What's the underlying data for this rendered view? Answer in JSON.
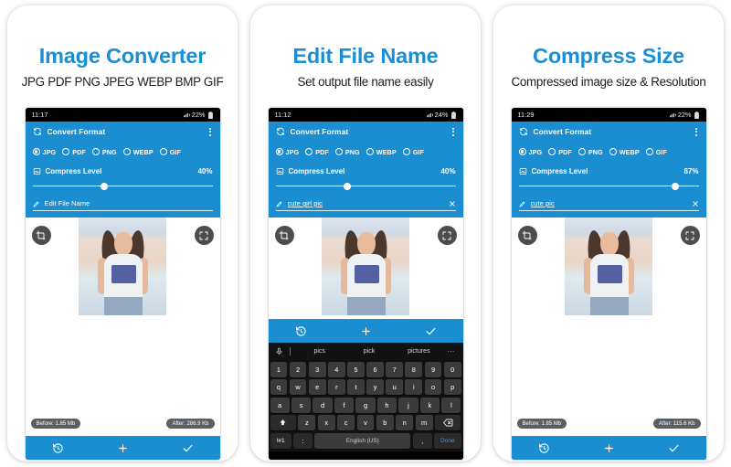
{
  "theme": {
    "title_blue": "#1c8fd4",
    "app_blue": "#1b8ed2",
    "card_bg": "#ffffff",
    "keyboard_bg": "#121212",
    "pill_bg": "#5a5f63"
  },
  "cards": [
    {
      "id": "card-image-converter",
      "title": "Image Converter",
      "subtitle": "JPG PDF PNG JPEG WEBP BMP GIF",
      "phone": {
        "status": {
          "time": "11:17",
          "battery": "22%"
        },
        "appbar": {
          "title": "Convert Format",
          "menu_icon": "kebab-menu-icon",
          "refresh_icon": "convert-format-icon"
        },
        "formats": [
          {
            "label": "JPG",
            "selected": true
          },
          {
            "label": "PDF",
            "selected": false
          },
          {
            "label": "PNG",
            "selected": false
          },
          {
            "label": "WEBP",
            "selected": false
          },
          {
            "label": "GIF",
            "selected": false
          }
        ],
        "compress": {
          "label": "Compress Level",
          "value": "40%",
          "percent": 40
        },
        "filename": {
          "value": "Edit File Name",
          "is_placeholder": true,
          "clear_icon": null
        },
        "image": {
          "crop_icon": "crop-rotate-icon",
          "expand_icon": "fullscreen-expand-icon",
          "before_label": "Before: 1.85 Mb",
          "after_label": "After: 286.9 Kb"
        },
        "bottombar": [
          {
            "name": "history-icon",
            "glyph": "history"
          },
          {
            "name": "add-icon",
            "glyph": "plus"
          },
          {
            "name": "confirm-icon",
            "glyph": "check"
          }
        ],
        "keyboard": null
      }
    },
    {
      "id": "card-edit-file-name",
      "title": "Edit File Name",
      "subtitle": "Set output file name easily",
      "phone": {
        "status": {
          "time": "11:12",
          "battery": "24%"
        },
        "appbar": {
          "title": "Convert Format",
          "menu_icon": "kebab-menu-icon",
          "refresh_icon": "convert-format-icon"
        },
        "formats": [
          {
            "label": "JPG",
            "selected": true
          },
          {
            "label": "PDF",
            "selected": false
          },
          {
            "label": "PNG",
            "selected": false
          },
          {
            "label": "WEBP",
            "selected": false
          },
          {
            "label": "GIF",
            "selected": false
          }
        ],
        "compress": {
          "label": "Compress Level",
          "value": "40%",
          "percent": 40
        },
        "filename": {
          "value": "cute girl pic",
          "is_placeholder": false,
          "clear_icon": "clear-text-icon"
        },
        "image": {
          "crop_icon": "crop-rotate-icon",
          "expand_icon": "fullscreen-expand-icon",
          "before_label": "",
          "after_label": ""
        },
        "bottombar": [
          {
            "name": "history-icon",
            "glyph": "history"
          },
          {
            "name": "add-icon",
            "glyph": "plus"
          },
          {
            "name": "confirm-icon",
            "glyph": "check"
          }
        ],
        "keyboard": {
          "mic_icon": "voice-input-icon",
          "suggestions": [
            "pics",
            "pick",
            "pictures"
          ],
          "more_icon": "more-options-icon",
          "rows": [
            [
              "1",
              "2",
              "3",
              "4",
              "5",
              "6",
              "7",
              "8",
              "9",
              "0"
            ],
            [
              "q",
              "w",
              "e",
              "r",
              "t",
              "y",
              "u",
              "i",
              "o",
              "p"
            ],
            [
              "a",
              "s",
              "d",
              "f",
              "g",
              "h",
              "j",
              "k",
              "l"
            ]
          ],
          "shift_icon": "shift-key-icon",
          "row4": [
            "z",
            "x",
            "c",
            "v",
            "b",
            "n",
            "m"
          ],
          "backspace_icon": "backspace-key-icon",
          "symbols_key": "!#1",
          "emoji_key": ":",
          "space_key": "English (US)",
          "comma_key": ",",
          "done_key": "Done"
        }
      }
    },
    {
      "id": "card-compress-size",
      "title": "Compress Size",
      "subtitle": "Compressed image size & Resolution",
      "phone": {
        "status": {
          "time": "11:29",
          "battery": "22%"
        },
        "appbar": {
          "title": "Convert Format",
          "menu_icon": "kebab-menu-icon",
          "refresh_icon": "convert-format-icon"
        },
        "formats": [
          {
            "label": "JPG",
            "selected": true
          },
          {
            "label": "PDF",
            "selected": false
          },
          {
            "label": "PNG",
            "selected": false
          },
          {
            "label": "WEBP",
            "selected": false
          },
          {
            "label": "GIF",
            "selected": false
          }
        ],
        "compress": {
          "label": "Compress Level",
          "value": "87%",
          "percent": 87
        },
        "filename": {
          "value": "cute pic",
          "is_placeholder": false,
          "clear_icon": "clear-text-icon"
        },
        "image": {
          "crop_icon": "crop-rotate-icon",
          "expand_icon": "fullscreen-expand-icon",
          "before_label": "Before: 1.85 Mb",
          "after_label": "After: 115.6 Kb"
        },
        "bottombar": [
          {
            "name": "history-icon",
            "glyph": "history"
          },
          {
            "name": "add-icon",
            "glyph": "plus"
          },
          {
            "name": "confirm-icon",
            "glyph": "check"
          }
        ],
        "keyboard": null
      }
    }
  ]
}
